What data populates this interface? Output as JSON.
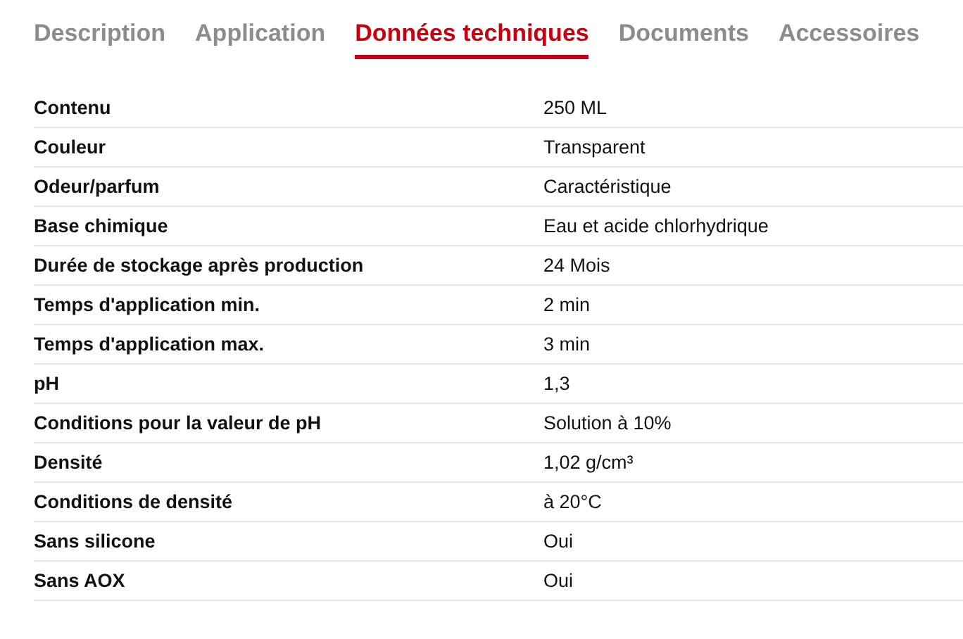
{
  "tabs": [
    {
      "label": "Description",
      "selected": false
    },
    {
      "label": "Application",
      "selected": false
    },
    {
      "label": "Données techniques",
      "selected": true
    },
    {
      "label": "Documents",
      "selected": false
    },
    {
      "label": "Accessoires",
      "selected": false
    }
  ],
  "table": {
    "rows": [
      {
        "label": "Contenu",
        "value": "250 ML"
      },
      {
        "label": "Couleur",
        "value": "Transparent"
      },
      {
        "label": "Odeur/parfum",
        "value": "Caractéristique"
      },
      {
        "label": "Base chimique",
        "value": "Eau et acide chlorhydrique"
      },
      {
        "label": "Durée de stockage après production",
        "value": "24 Mois"
      },
      {
        "label": "Temps d'application min.",
        "value": "2 min"
      },
      {
        "label": "Temps d'application max.",
        "value": "3 min"
      },
      {
        "label": "pH",
        "value": "1,3"
      },
      {
        "label": "Conditions pour la valeur de pH",
        "value": "Solution à 10%"
      },
      {
        "label": "Densité",
        "value": "1,02 g/cm³"
      },
      {
        "label": "Conditions de densité",
        "value": "à 20°C"
      },
      {
        "label": "Sans silicone",
        "value": "Oui"
      },
      {
        "label": "Sans AOX",
        "value": "Oui"
      }
    ]
  }
}
